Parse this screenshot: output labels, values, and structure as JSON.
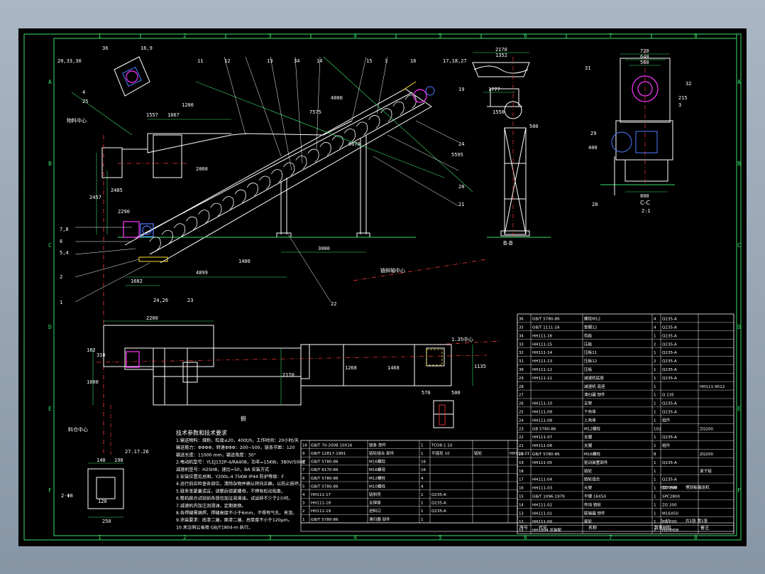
{
  "grid": {
    "cols": [
      "1",
      "2",
      "3",
      "4",
      "5",
      "6",
      "7",
      "8"
    ],
    "rows": [
      "A",
      "B",
      "C",
      "D",
      "E",
      "F"
    ]
  },
  "views": {
    "side_section": "B-B",
    "top_view": "俯",
    "cc_section": "C-C",
    "cc_scale": "2:1",
    "center_label_top": "物料中心",
    "center_label_left": "料仓中心",
    "incline_center_1": "链斜轴中心",
    "incline_center_2": "1.35中心"
  },
  "callouts_main": [
    "20,33,30",
    "36",
    "16,9",
    "12",
    "11",
    "13",
    "34",
    "14",
    "15",
    "3",
    "16",
    "17,18,27",
    "19",
    "4",
    "25",
    "24",
    "20",
    "21",
    "22",
    "7,8",
    "6",
    "5,4",
    "2",
    "1",
    "24,26",
    "23"
  ],
  "callouts_cc": [
    "31",
    "720",
    "640",
    "560",
    "32",
    "29",
    "28",
    "3",
    "215",
    "800",
    "400"
  ],
  "dims_main": [
    "1557",
    "1667",
    "2457",
    "2485",
    "1400",
    "3000",
    "4899",
    "1682",
    "2290",
    "2060",
    "5595",
    "6670",
    "7575",
    "4000",
    "1200"
  ],
  "dims_bb": [
    "2170",
    "1352",
    "1777",
    "1550",
    "500"
  ],
  "dims_top": [
    "2200",
    "162",
    "310",
    "1000",
    "2170",
    "1268",
    "1468",
    "1135",
    "570",
    "500",
    "27.17.26"
  ],
  "dims_bottom_detail": [
    "140",
    "190",
    "120",
    "250",
    "2-Φ8"
  ],
  "notes": {
    "title": "技术参数和技术要求",
    "lines": [
      "1.输送物料：煤粉，粒度≤20，400t/h，工作时间：20小时/天",
      "  输送能力：ΦΦΦΦ，转速ΦΦΦ：200~500，链条节距：120",
      "  输送长度：11000 mm，输送角度：30°",
      "2.电动机型号：YLEJ132P-4/RA408，功率=15KW，380V/50HZ",
      "  减速机型号：H2SH8，速比=50，BA 安装方式",
      "3.安装位置见总图，Y200L-4 75KW IP44 防护等级：F",
      "4.运行前应检查各部位，清除杂物并确认转向正确，以防止损坏。",
      "5.链条张紧量适宜，调整后锁紧螺母，不得有松动现象。",
      "6.整机跑合试验前各部位加注润滑油，试运转不少于2小时。",
      "7.减速机内加注润滑油，定期更换。",
      "8.各焊缝需满焊，焊缝高度不小于6mm，不得有气孔、夹渣。",
      "9.涂装要求：底漆二遍，面漆二遍，总厚度不小于120μm。",
      "10.未注明公差按 GB/T1804-m 执行。"
    ]
  },
  "parts_right": [
    [
      "36",
      "GB/T 5780-86",
      "螺栓M12",
      "4",
      "Q235-A",
      ""
    ],
    [
      "35",
      "GB/T 1111-16",
      "垫圈12",
      "4",
      "Q235-A",
      ""
    ],
    [
      "34",
      "HH111-16",
      "挡板",
      "1",
      "Q235-A",
      ""
    ],
    [
      "33",
      "HH111-15",
      "压板",
      "2",
      "Q235-A",
      ""
    ],
    [
      "32",
      "HH111-14",
      "压板11",
      "1",
      "Q235-A",
      ""
    ],
    [
      "31",
      "HH111-13",
      "压板12",
      "2",
      "Q235-A",
      ""
    ],
    [
      "30",
      "HH111-12",
      "压板",
      "1",
      "Q235-A",
      ""
    ],
    [
      "29",
      "HH111-11",
      "减速机底座",
      "1",
      "Q235-A",
      ""
    ],
    [
      "28",
      "",
      "减速机 底座",
      "1",
      "",
      "HH111-9512"
    ],
    [
      "27",
      "",
      "清扫器 部件",
      "1",
      "Q 235",
      ""
    ],
    [
      "26",
      "HH111-10",
      "支架",
      "1",
      "Q235-A",
      ""
    ],
    [
      "25",
      "HH111-09",
      "下壳体",
      "1",
      "Q235-A",
      ""
    ],
    [
      "24",
      "HH111-08",
      "上壳体",
      "1",
      "组件",
      ""
    ],
    [
      "23",
      "GB 5780-86",
      "M12螺栓",
      "102",
      "",
      "ZQ200"
    ],
    [
      "22",
      "HH111-07",
      "支腿",
      "1",
      "Q235-A",
      ""
    ],
    [
      "21",
      "HH111-06",
      "支腿",
      "1",
      "组件",
      ""
    ],
    [
      "20",
      "GB/T 5780-86",
      "M16螺栓",
      "8",
      "",
      "ZQ200"
    ],
    [
      "19",
      "HH111-05",
      "驱动装置部件",
      "1",
      "Q235-A",
      ""
    ],
    [
      "18",
      "",
      "链轮",
      "1",
      "",
      "滚子链"
    ],
    [
      "17",
      "HH111-04",
      "链轮组合",
      "1",
      "Q235-A",
      ""
    ],
    [
      "16",
      "HH111-03",
      "头架",
      "1",
      "ZG 200",
      ""
    ],
    [
      "15",
      "GB/T 1096-1979",
      "平键 16X50",
      "1",
      "SPC2800",
      ""
    ],
    [
      "14",
      "HH111-02",
      "传动 链轮",
      "1",
      "ZG 200",
      ""
    ],
    [
      "13",
      "HH111-01",
      "联轴器 部件",
      "1",
      "M16X50",
      ""
    ],
    [
      "12",
      "HH111-00",
      "尾轮",
      "1",
      "ZG 200",
      ""
    ],
    [
      "11",
      "HH1004 总装配",
      "",
      "1",
      "H2HH08",
      ""
    ]
  ],
  "parts_bottom": [
    [
      "10",
      "GB/T 70-2008 10X16",
      "链条 部件",
      "1",
      "TCO8-1 10",
      "",
      ""
    ],
    [
      "9",
      "GB/T 12817-1991",
      "链轮组合 部件",
      "1",
      "平链轮 10",
      "链轮",
      "HH111-21"
    ],
    [
      "8",
      "GB/T 5780-86",
      "M16螺栓",
      "16",
      "",
      "",
      ""
    ],
    [
      "7",
      "GB/T 6170-86",
      "M16螺母",
      "16",
      "",
      "",
      ""
    ],
    [
      "6",
      "GB/T 5780-86",
      "M12螺栓",
      "4",
      "",
      "",
      ""
    ],
    [
      "5",
      "GB/T 5780-86",
      "M10螺栓",
      "4",
      "",
      "",
      ""
    ],
    [
      "4",
      "HH111-17",
      "链斜壳",
      "1",
      "Q235-A",
      "",
      ""
    ],
    [
      "3",
      "HH111-18",
      "支撑座",
      "1",
      "Q235-A",
      "",
      ""
    ],
    [
      "2",
      "HH111-19",
      "进料口",
      "1",
      "Q235-A",
      "",
      ""
    ],
    [
      "1",
      "GB/T 5780-86",
      "清扫器 部件",
      "1",
      "",
      "",
      ""
    ]
  ],
  "table_headers": [
    "序号",
    "代号",
    "名称",
    "数量",
    "材料",
    "备注"
  ],
  "title_block": {
    "drawing_no": "HZHH08",
    "name": "埋刮板输送机",
    "scale": "1:15",
    "sheet": "共1张 第1张"
  },
  "colors": {
    "background": "#000000",
    "frame": "#39e06a",
    "outline": "#ffffff",
    "hidden": "#ff3b3b",
    "center": "#ff3b3b",
    "dim": "#39e06a",
    "magenta": "#ff36ff",
    "blue": "#4f7bff",
    "yellow": "#ffe033",
    "cyan": "#2ee6e6"
  }
}
